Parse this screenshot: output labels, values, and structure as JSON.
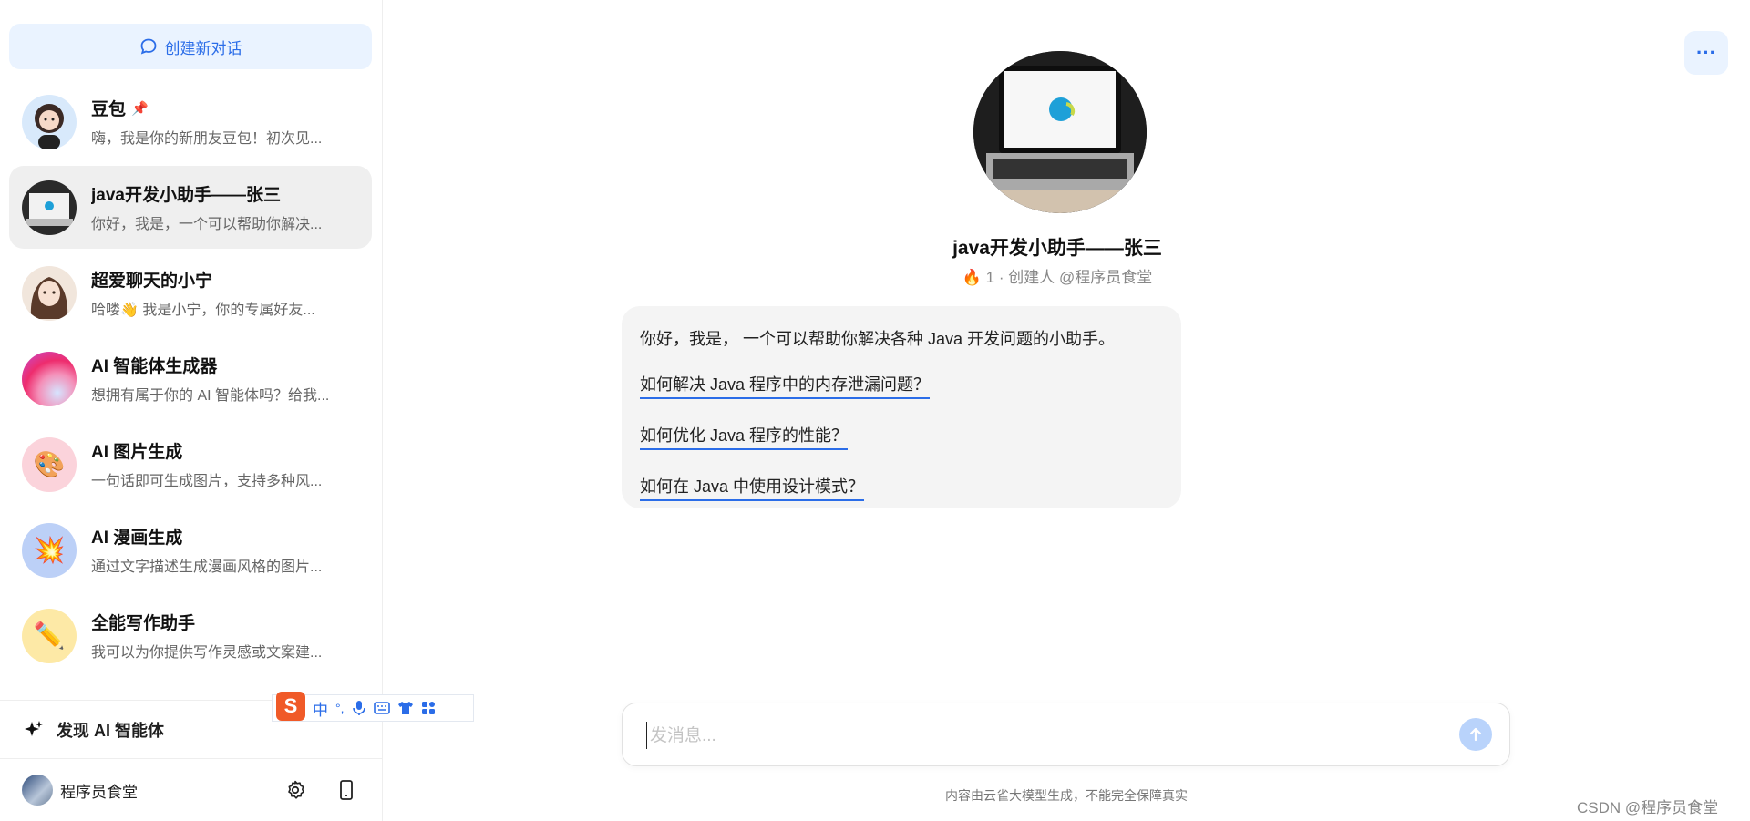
{
  "sidebar": {
    "new_chat_label": "创建新对话",
    "items": [
      {
        "name": "豆包",
        "preview": "嗨，我是你的新朋友豆包！初次见...",
        "pinned": true,
        "avatar_icon": "girl-avatar-icon",
        "avatar_bg": "#d8e9fb"
      },
      {
        "name": "java开发小助手——张三",
        "preview": "你好，我是，一个可以帮助你解决...",
        "active": true,
        "avatar_icon": "laptop-avatar-icon",
        "avatar_bg": "#2a2a2a"
      },
      {
        "name": "超爱聊天的小宁",
        "preview": "哈喽👋 我是小宁，你的专属好友...",
        "avatar_icon": "girl-avatar-icon",
        "avatar_bg": "#f1e6dc"
      },
      {
        "name": "AI 智能体生成器",
        "preview": "想拥有属于你的 AI 智能体吗？给我...",
        "avatar_icon": "gradient-orb-icon",
        "avatar_bg": "#f04880"
      },
      {
        "name": "AI 图片生成",
        "preview": "一句话即可生成图片，支持多种风...",
        "avatar_icon": "palette-icon",
        "avatar_bg": "#fbd3db",
        "glyph": "🎨"
      },
      {
        "name": "AI 漫画生成",
        "preview": "通过文字描述生成漫画风格的图片...",
        "avatar_icon": "explosion-icon",
        "avatar_bg": "#bcd0f7",
        "glyph": "💥"
      },
      {
        "name": "全能写作助手",
        "preview": "我可以为你提供写作灵感或文案建...",
        "avatar_icon": "pencil-icon",
        "avatar_bg": "#fde9a6",
        "glyph": "✏️"
      }
    ],
    "discover_label": "发现 AI 智能体",
    "user_name": "程序员食堂"
  },
  "ime": {
    "lang": "中",
    "punct": "°,"
  },
  "main": {
    "bot_name": "java开发小助手——张三",
    "bot_meta": "1 · 创建人 @程序员食堂",
    "greeting": "你好，我是， 一个可以帮助你解决各种 Java 开发问题的小助手。",
    "suggestions": [
      "如何解决 Java 程序中的内存泄漏问题？",
      "如何优化 Java 程序的性能？",
      "如何在 Java 中使用设计模式？"
    ],
    "input_placeholder": "发消息...",
    "disclaimer": "内容由云雀大模型生成，不能完全保障真实",
    "watermark": "CSDN @程序员食堂"
  },
  "colors": {
    "accent": "#2b6de8",
    "accent_light": "#eaf3ff",
    "active_bg": "#efefef"
  }
}
